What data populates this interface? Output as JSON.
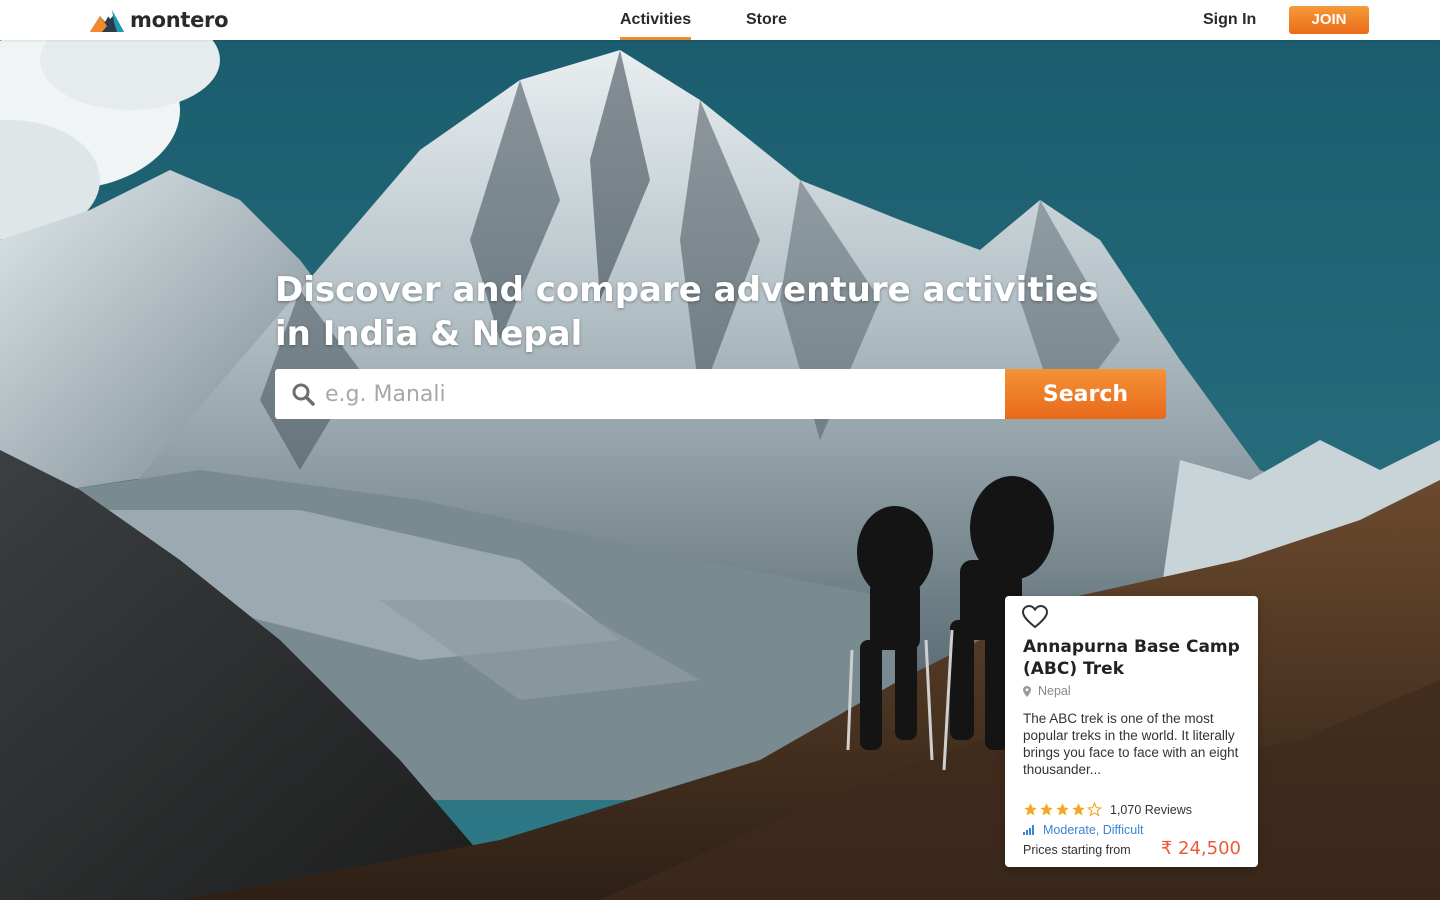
{
  "brand": {
    "name": "montero"
  },
  "nav": {
    "links": [
      {
        "label": "Activities",
        "active": true
      },
      {
        "label": "Store",
        "active": false
      }
    ],
    "signin_label": "Sign In",
    "join_label": "JOIN"
  },
  "hero": {
    "headline": "Discover and compare adventure activities in India & Nepal",
    "search": {
      "placeholder": "e.g. Manali",
      "value": "",
      "button_label": "Search"
    }
  },
  "featured_card": {
    "title": "Annapurna Base Camp (ABC) Trek",
    "location": "Nepal",
    "description": "The ABC trek is one of the most popular treks in the world. It literally brings you face to face with an eight thousander...",
    "rating_stars": 4,
    "rating_max": 5,
    "reviews": "1,070 Reviews",
    "difficulty": "Moderate, Difficult",
    "price_label": "Prices starting from",
    "price": "₹ 24,500"
  },
  "colors": {
    "accent": "#f08a2c",
    "price": "#f05a3c",
    "difficulty": "#3a86d6",
    "star": "#f5a623"
  },
  "icons": [
    "mountain-logo-icon",
    "search-icon",
    "heart-icon",
    "map-pin-icon",
    "star-icon",
    "difficulty-bars-icon"
  ]
}
